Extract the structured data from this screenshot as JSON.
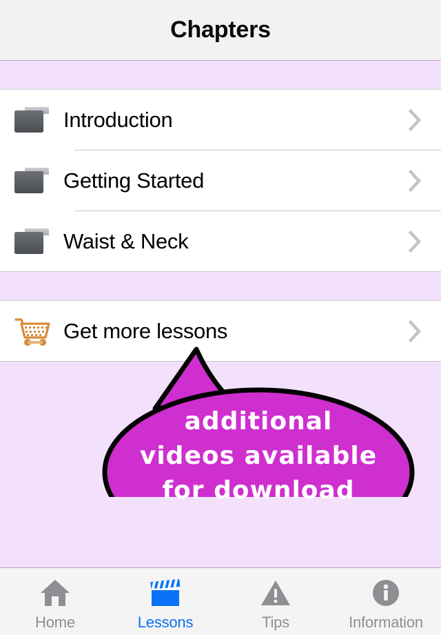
{
  "navbar": {
    "title": "Chapters"
  },
  "colors": {
    "section_band": "#f3e1fb",
    "navbar_bg": "#f2f2f2",
    "row_bg": "#ffffff",
    "separator": "#c8c7cc",
    "chevron": "#c2c2c7",
    "bubble_fill": "#cf2fcf",
    "bubble_stroke": "#000000",
    "bubble_text": "#ffffff",
    "cart_icon": "#d78b36",
    "folder_icon": "#5b5e63",
    "tab_active": "#0a72f5",
    "tab_inactive": "#8e8e93"
  },
  "sections": [
    {
      "name": "chapters-section",
      "header_label": "",
      "rows": [
        {
          "label": "Introduction",
          "icon": "folder-icon",
          "accessory": "chevron-right-icon"
        },
        {
          "label": "Getting Started",
          "icon": "folder-icon",
          "accessory": "chevron-right-icon"
        },
        {
          "label": "Waist & Neck",
          "icon": "folder-icon",
          "accessory": "chevron-right-icon"
        }
      ]
    },
    {
      "name": "store-section",
      "header_label": "",
      "rows": [
        {
          "label": "Get more lessons",
          "icon": "shopping-cart-icon",
          "accessory": "chevron-right-icon"
        }
      ]
    }
  ],
  "callout": {
    "lines": [
      "additional",
      "videos available",
      "for download"
    ],
    "full_text": "additional videos available for download"
  },
  "tabbar": {
    "items": [
      {
        "label": "Home",
        "icon": "house-icon",
        "active": false
      },
      {
        "label": "Lessons",
        "icon": "clapperboard-icon",
        "active": true
      },
      {
        "label": "Tips",
        "icon": "warning-triangle-icon",
        "active": false
      },
      {
        "label": "Information",
        "icon": "info-circle-icon",
        "active": false
      }
    ]
  }
}
